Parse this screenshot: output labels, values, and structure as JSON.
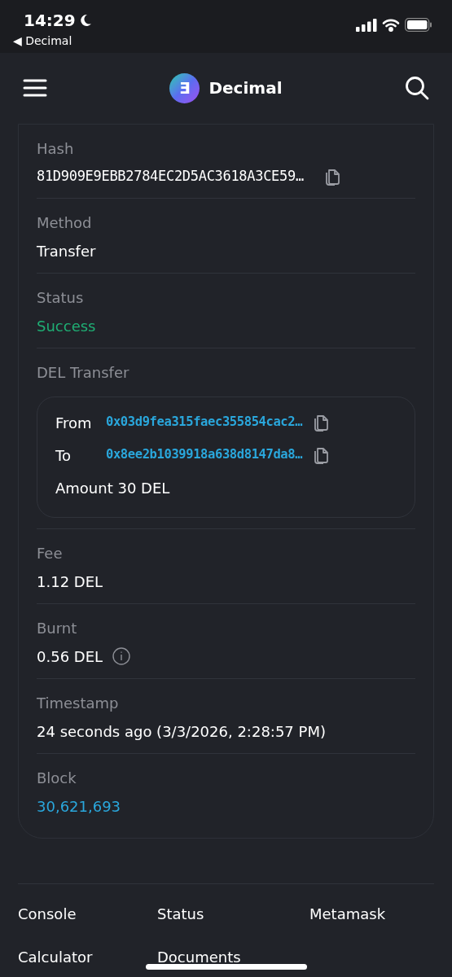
{
  "status_bar": {
    "time": "14:29",
    "back_label": "◀ Decimal"
  },
  "header": {
    "title": "Decimal",
    "logo_letter": "Ǝ"
  },
  "fields": [
    {
      "kind": "hash",
      "label": "Hash",
      "value": "81D909E9EBB2784EC2D5AC3618A3CE59…"
    },
    {
      "kind": "text",
      "label": "Method",
      "value": "Transfer"
    },
    {
      "kind": "status",
      "label": "Status",
      "value": "Success",
      "color": "#1fae74"
    },
    {
      "kind": "transfer",
      "label": "DEL Transfer",
      "from_label": "From",
      "from": "0x03d9fea315faec355854cac2…",
      "to_label": "To",
      "to": "0x8ee2b1039918a638d8147da8…",
      "amount": "Amount 30 DEL"
    },
    {
      "kind": "text",
      "label": "Fee",
      "value": "1.12 DEL"
    },
    {
      "kind": "info",
      "label": "Burnt",
      "value": "0.56 DEL"
    },
    {
      "kind": "text",
      "label": "Timestamp",
      "value": "24 seconds ago (3/3/2026, 2:28:57 PM)"
    },
    {
      "kind": "link",
      "label": "Block",
      "value": "30,621,693"
    }
  ],
  "footer_links": [
    "Console",
    "Status",
    "Metamask",
    "Calculator",
    "Documents"
  ]
}
